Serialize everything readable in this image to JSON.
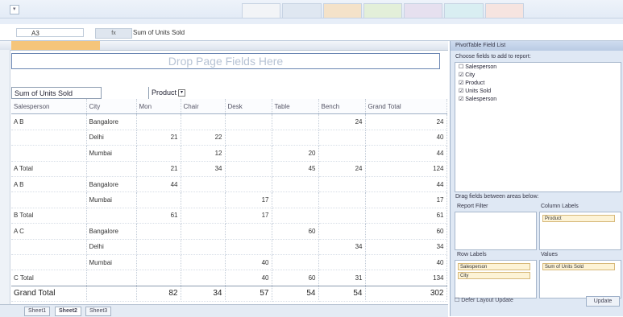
{
  "formula_bar": {
    "name_box": "A3",
    "fx_label": "fx",
    "content": "Sum of Units Sold"
  },
  "pivot": {
    "drop_page_fields": "Drop Page Fields Here",
    "value_field": "Sum of Units Sold",
    "column_field": "Product",
    "headers": [
      "Salesperson",
      "City",
      "Mon",
      "Chair",
      "Desk",
      "Table",
      "Bench",
      "Grand Total"
    ],
    "rows": [
      {
        "sp": "A B",
        "city": "Bangalore",
        "vals": [
          "",
          "",
          "",
          "",
          "24",
          "24"
        ]
      },
      {
        "sp": "",
        "city": "Delhi",
        "vals": [
          "21",
          "22",
          "",
          "",
          "",
          "40"
        ]
      },
      {
        "sp": "",
        "city": "Mumbai",
        "vals": [
          "",
          "12",
          "",
          "20",
          "",
          "44"
        ]
      },
      {
        "sp": "A Total",
        "city": "",
        "vals": [
          "21",
          "34",
          "",
          "45",
          "24",
          "124"
        ]
      },
      {
        "sp": "A B",
        "city": "Bangalore",
        "vals": [
          "44",
          "",
          "",
          "",
          "",
          "44"
        ]
      },
      {
        "sp": "",
        "city": "Mumbai",
        "vals": [
          "",
          "",
          "17",
          "",
          "",
          "17"
        ]
      },
      {
        "sp": "B Total",
        "city": "",
        "vals": [
          "61",
          "",
          "17",
          "",
          "",
          "61"
        ]
      },
      {
        "sp": "A C",
        "city": "Bangalore",
        "vals": [
          "",
          "",
          "",
          "60",
          "",
          "60"
        ]
      },
      {
        "sp": "",
        "city": "Delhi",
        "vals": [
          "",
          "",
          "",
          "",
          "34",
          "34"
        ]
      },
      {
        "sp": "",
        "city": "Mumbai",
        "vals": [
          "",
          "",
          "40",
          "",
          "",
          "40"
        ]
      },
      {
        "sp": "C Total",
        "city": "",
        "vals": [
          "",
          "",
          "40",
          "60",
          "31",
          "134"
        ]
      }
    ],
    "grand_total": {
      "label": "Grand Total",
      "vals": [
        "82",
        "34",
        "57",
        "54",
        "54",
        "302"
      ]
    }
  },
  "sheets": [
    "Sheet1",
    "Sheet2",
    "Sheet3"
  ],
  "field_list": {
    "title": "PivotTable Field List",
    "prompt": "Choose fields to add to report:",
    "fields": [
      "Salesperson",
      "City",
      "Product",
      "Units Sold",
      "Salesperson"
    ],
    "drag_hint": "Drag fields between areas below:",
    "zones": {
      "report_filter": "Report Filter",
      "column_labels": "Column Labels",
      "row_labels": "Row Labels",
      "values": "Values"
    },
    "chips": {
      "column": "Product",
      "row1": "Salesperson",
      "row2": "City",
      "value": "Sum of Units Sold"
    },
    "defer": "Defer Layout Update",
    "update": "Update"
  }
}
